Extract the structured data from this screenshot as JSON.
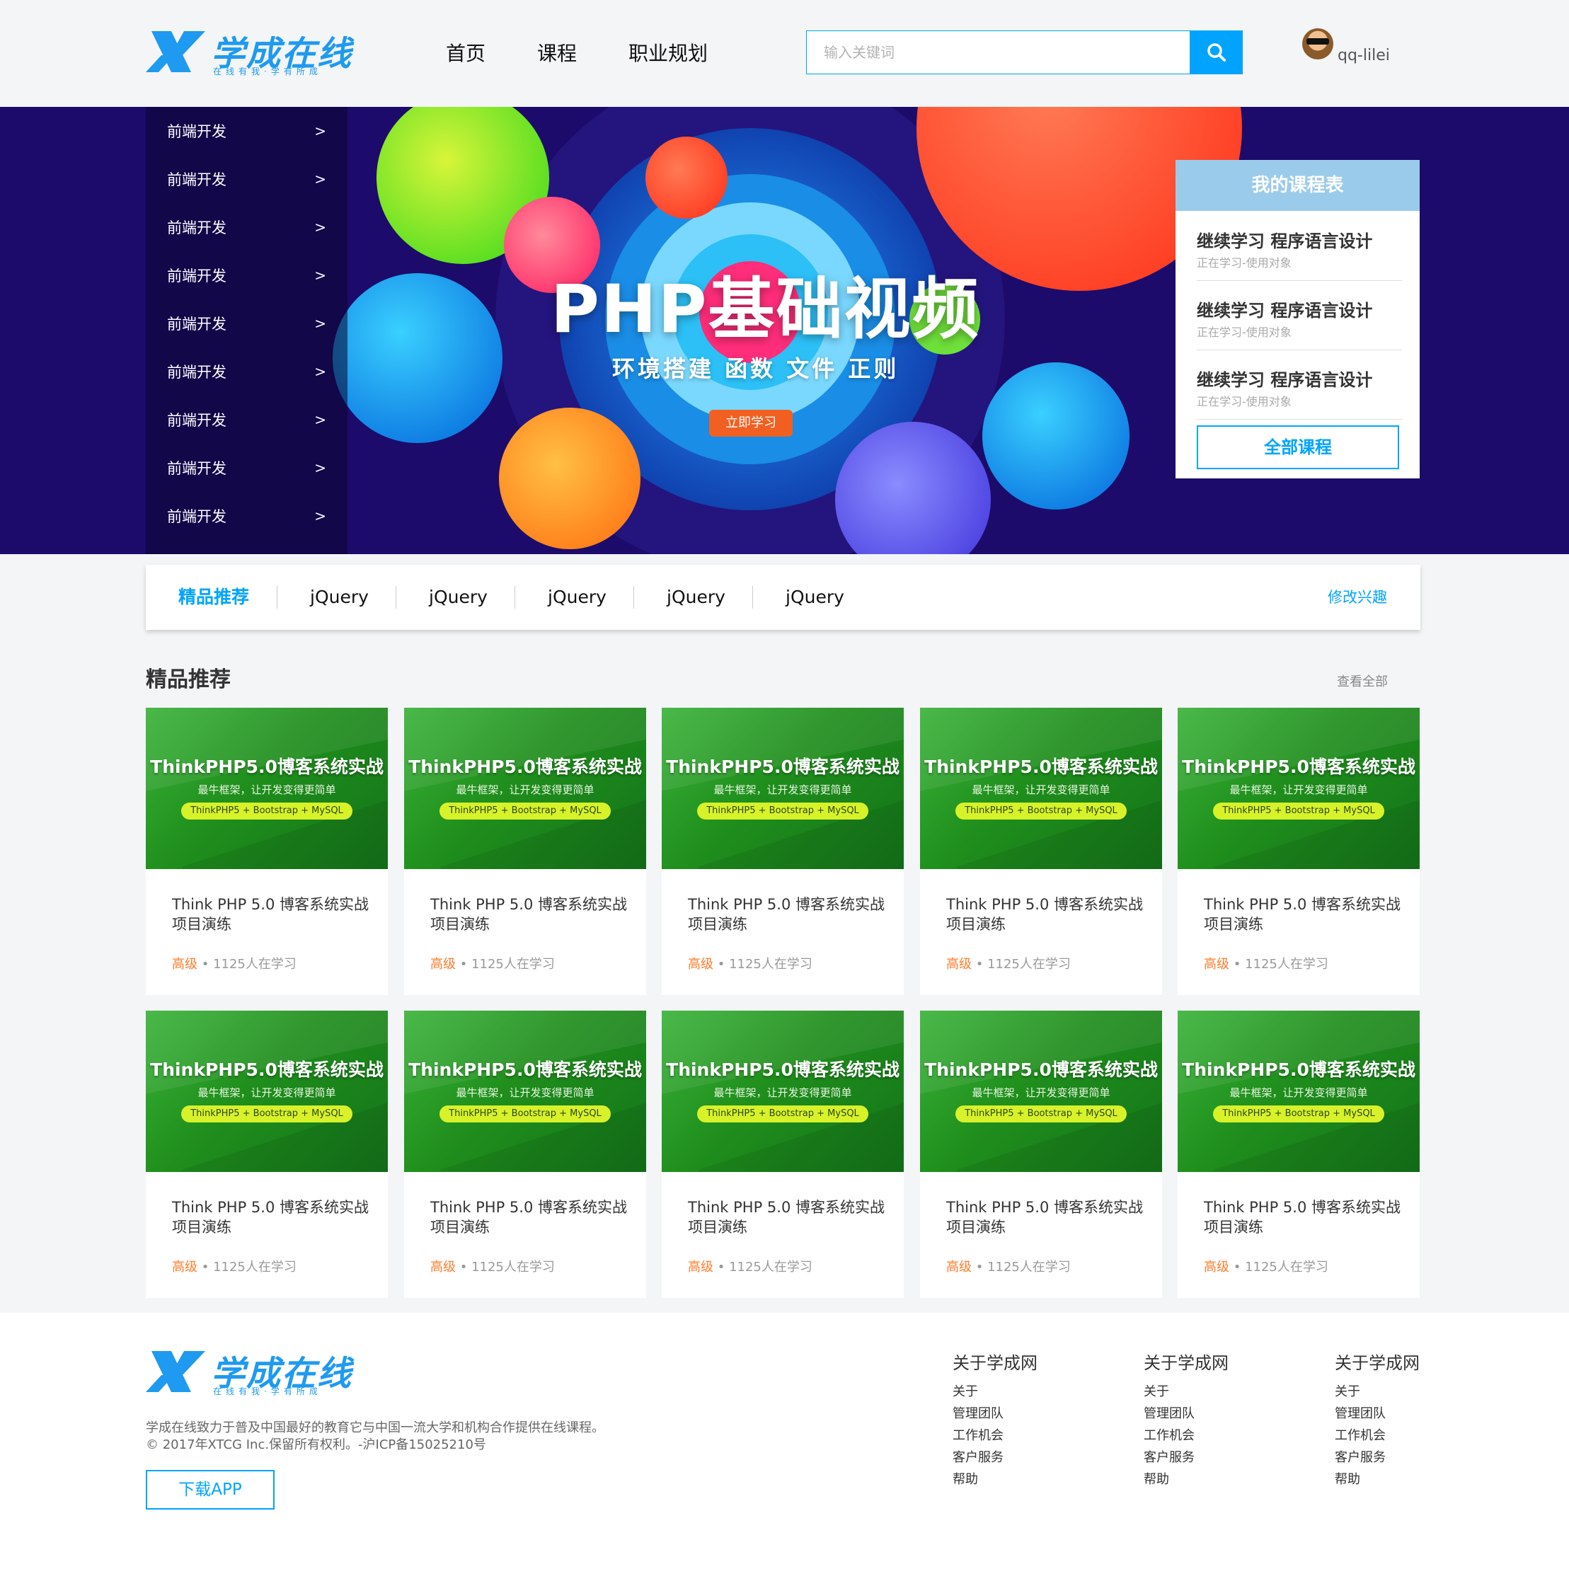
{
  "brand": {
    "name": "学成在线",
    "tagline": "在线有我·学有所成"
  },
  "nav": [
    "首页",
    "课程",
    "职业规划"
  ],
  "search": {
    "placeholder": "输入关键词"
  },
  "user": {
    "name": "qq-lilei"
  },
  "categories": [
    "前端开发",
    "前端开发",
    "前端开发",
    "前端开发",
    "前端开发",
    "前端开发",
    "前端开发",
    "前端开发",
    "前端开发"
  ],
  "banner": {
    "title": "PHP基础视频",
    "subtitle": "环境搭建  函数 文件  正则",
    "cta": "立即学习"
  },
  "schedule": {
    "title": "我的课程表",
    "items": [
      {
        "title": "继续学习 程序语言设计",
        "sub": "正在学习-使用对象"
      },
      {
        "title": "继续学习 程序语言设计",
        "sub": "正在学习-使用对象"
      },
      {
        "title": "继续学习 程序语言设计",
        "sub": "正在学习-使用对象"
      }
    ],
    "button": "全部课程"
  },
  "filter": {
    "tabs": [
      "精品推荐",
      "jQuery",
      "jQuery",
      "jQuery",
      "jQuery",
      "jQuery"
    ],
    "edit": "修改兴趣"
  },
  "recommend": {
    "title": "精品推荐",
    "view_all": "查看全部"
  },
  "course_thumb": {
    "title": "ThinkPHP5.0博客系统实战",
    "sub": "最牛框架，让开发变得更简单",
    "tags": "ThinkPHP5 + Bootstrap + MySQL"
  },
  "courses": [
    {
      "name": "Think PHP 5.0 博客系统实战项目演练",
      "level": "高级",
      "learners": "1125人在学习"
    },
    {
      "name": "Think PHP 5.0 博客系统实战项目演练",
      "level": "高级",
      "learners": "1125人在学习"
    },
    {
      "name": "Think PHP 5.0 博客系统实战项目演练",
      "level": "高级",
      "learners": "1125人在学习"
    },
    {
      "name": "Think PHP 5.0 博客系统实战项目演练",
      "level": "高级",
      "learners": "1125人在学习"
    },
    {
      "name": "Think PHP 5.0 博客系统实战项目演练",
      "level": "高级",
      "learners": "1125人在学习"
    },
    {
      "name": "Think PHP 5.0 博客系统实战项目演练",
      "level": "高级",
      "learners": "1125人在学习"
    },
    {
      "name": "Think PHP 5.0 博客系统实战项目演练",
      "level": "高级",
      "learners": "1125人在学习"
    },
    {
      "name": "Think PHP 5.0 博客系统实战项目演练",
      "level": "高级",
      "learners": "1125人在学习"
    },
    {
      "name": "Think PHP 5.0 博客系统实战项目演练",
      "level": "高级",
      "learners": "1125人在学习"
    },
    {
      "name": "Think PHP 5.0 博客系统实战项目演练",
      "level": "高级",
      "learners": "1125人在学习"
    }
  ],
  "footer": {
    "desc1": "学成在线致力于普及中国最好的教育它与中国一流大学和机构合作提供在线课程。",
    "desc2": "© 2017年XTCG Inc.保留所有权利。-沪ICP备15025210号",
    "download": "下载APP",
    "columns": [
      {
        "title": "关于学成网",
        "links": [
          "关于",
          "管理团队",
          "工作机会",
          "客户服务",
          "帮助"
        ]
      },
      {
        "title": "关于学成网",
        "links": [
          "关于",
          "管理团队",
          "工作机会",
          "客户服务",
          "帮助"
        ]
      },
      {
        "title": "关于学成网",
        "links": [
          "关于",
          "管理团队",
          "工作机会",
          "客户服务",
          "帮助"
        ]
      }
    ]
  },
  "colors": {
    "accent": "#00a4ff",
    "banner_bg": "#1c0b6a",
    "level": "#ff7c2d",
    "schedule_head": "#9bcbea"
  }
}
